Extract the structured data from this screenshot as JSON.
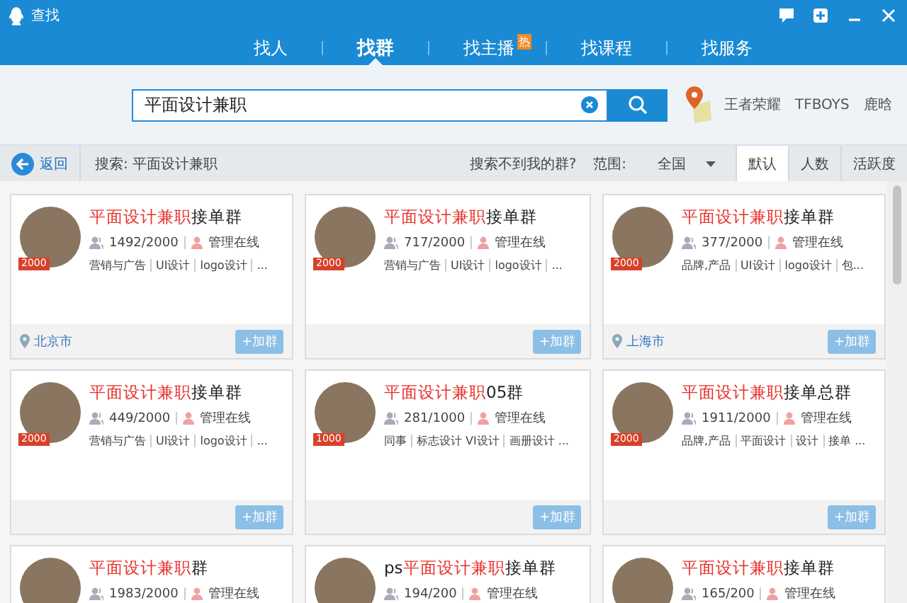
{
  "window": {
    "title": "查找"
  },
  "tabs": [
    {
      "label": "找人",
      "selected": false
    },
    {
      "label": "找群",
      "selected": true
    },
    {
      "label": "找主播",
      "selected": false,
      "badge": "热"
    },
    {
      "label": "找课程",
      "selected": false
    },
    {
      "label": "找服务",
      "selected": false
    }
  ],
  "search": {
    "value": "平面设计兼职",
    "hot_words": [
      "王者荣耀",
      "TFBOYS",
      "鹿晗"
    ]
  },
  "toolbar": {
    "back": "返回",
    "query": "搜索: 平面设计兼职",
    "help_link": "搜索不到我的群?",
    "range_label": "范围:",
    "range_value": "全国",
    "sort_tabs": [
      {
        "label": "默认",
        "selected": true
      },
      {
        "label": "人数",
        "selected": false
      },
      {
        "label": "活跃度",
        "selected": false
      }
    ]
  },
  "groups": [
    {
      "badge": "2000",
      "highlight": "平面设计兼职",
      "suffix": "接单群",
      "members": "1492/2000",
      "admin": "管理在线",
      "tags": [
        "营销与广告",
        "UI设计",
        "logo设计",
        "..."
      ],
      "location": "北京市",
      "join": "+加群"
    },
    {
      "badge": "2000",
      "highlight": "平面设计兼职",
      "suffix": "接单群",
      "members": "717/2000",
      "admin": "管理在线",
      "tags": [
        "营销与广告",
        "UI设计",
        "logo设计",
        "..."
      ],
      "join": "+加群"
    },
    {
      "badge": "2000",
      "highlight": "平面设计兼职",
      "suffix": "接单群",
      "members": "377/2000",
      "admin": "管理在线",
      "tags": [
        "品牌,产品",
        "UI设计",
        "logo设计",
        "包..."
      ],
      "location": "上海市",
      "join": "+加群"
    },
    {
      "badge": "2000",
      "highlight": "平面设计兼职",
      "suffix": "接单群",
      "members": "449/2000",
      "admin": "管理在线",
      "tags": [
        "营销与广告",
        "UI设计",
        "logo设计",
        "..."
      ],
      "join": "+加群"
    },
    {
      "badge": "1000",
      "highlight": "平面设计兼职",
      "suffix": "05群",
      "members": "281/1000",
      "admin": "管理在线",
      "tags": [
        "同事",
        "标志设计 VI设计",
        "画册设计 ..."
      ],
      "join": "+加群"
    },
    {
      "badge": "2000",
      "highlight": "平面设计兼职",
      "suffix": "接单总群",
      "members": "1911/2000",
      "admin": "管理在线",
      "tags": [
        "品牌,产品",
        "平面设计",
        "设计",
        "接单 ..."
      ],
      "join": "+加群"
    },
    {
      "highlight": "平面设计兼职",
      "suffix": "群",
      "members": "1983/2000",
      "admin": "管理在线"
    },
    {
      "prefix": "ps",
      "highlight": "平面设计兼职",
      "suffix": "接单群",
      "members": "194/200",
      "admin": "管理在线"
    },
    {
      "highlight": "平面设计兼职",
      "suffix": "接单群",
      "members": "165/200",
      "admin": "管理在线"
    }
  ]
}
